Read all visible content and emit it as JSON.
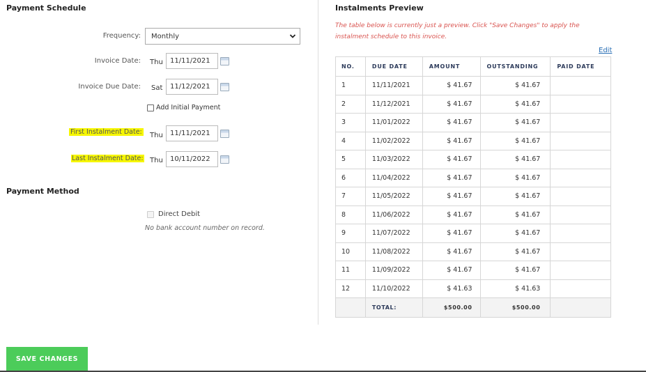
{
  "schedule": {
    "title": "Payment Schedule",
    "frequency_label": "Frequency:",
    "frequency_value": "Monthly",
    "invoice_date_label": "Invoice Date:",
    "invoice_date_day": "Thu",
    "invoice_date_value": "11/11/2021",
    "invoice_due_label": "Invoice Due Date:",
    "invoice_due_day": "Sat",
    "invoice_due_value": "11/12/2021",
    "add_initial_label": "Add Initial Payment",
    "first_inst_label": "First Instalment Date:",
    "first_inst_day": "Thu",
    "first_inst_value": "11/11/2021",
    "last_inst_label": "Last Instalment Date:",
    "last_inst_day": "Thu",
    "last_inst_value": "10/11/2022"
  },
  "method": {
    "title": "Payment Method",
    "direct_debit_label": "Direct Debit",
    "no_bank_text": "No bank account number on record."
  },
  "preview": {
    "title": "Instalments Preview",
    "note_line1": "The table below is currently just a preview. Click \"Save Changes\" to apply the",
    "note_line2": "instalment schedule to this invoice.",
    "edit_label": "Edit",
    "headers": {
      "no": "NO.",
      "due_date": "DUE DATE",
      "amount": "AMOUNT",
      "outstanding": "OUTSTANDING",
      "paid_date": "PAID DATE"
    },
    "rows": [
      {
        "no": "1",
        "due": "11/11/2021",
        "amount": "$ 41.67",
        "outstanding": "$ 41.67",
        "paid": ""
      },
      {
        "no": "2",
        "due": "11/12/2021",
        "amount": "$ 41.67",
        "outstanding": "$ 41.67",
        "paid": ""
      },
      {
        "no": "3",
        "due": "11/01/2022",
        "amount": "$ 41.67",
        "outstanding": "$ 41.67",
        "paid": ""
      },
      {
        "no": "4",
        "due": "11/02/2022",
        "amount": "$ 41.67",
        "outstanding": "$ 41.67",
        "paid": ""
      },
      {
        "no": "5",
        "due": "11/03/2022",
        "amount": "$ 41.67",
        "outstanding": "$ 41.67",
        "paid": ""
      },
      {
        "no": "6",
        "due": "11/04/2022",
        "amount": "$ 41.67",
        "outstanding": "$ 41.67",
        "paid": ""
      },
      {
        "no": "7",
        "due": "11/05/2022",
        "amount": "$ 41.67",
        "outstanding": "$ 41.67",
        "paid": ""
      },
      {
        "no": "8",
        "due": "11/06/2022",
        "amount": "$ 41.67",
        "outstanding": "$ 41.67",
        "paid": ""
      },
      {
        "no": "9",
        "due": "11/07/2022",
        "amount": "$ 41.67",
        "outstanding": "$ 41.67",
        "paid": ""
      },
      {
        "no": "10",
        "due": "11/08/2022",
        "amount": "$ 41.67",
        "outstanding": "$ 41.67",
        "paid": ""
      },
      {
        "no": "11",
        "due": "11/09/2022",
        "amount": "$ 41.67",
        "outstanding": "$ 41.67",
        "paid": ""
      },
      {
        "no": "12",
        "due": "11/10/2022",
        "amount": "$ 41.63",
        "outstanding": "$ 41.63",
        "paid": ""
      }
    ],
    "total_label": "TOTAL:",
    "total_amount": "$500.00",
    "total_outstanding": "$500.00"
  },
  "actions": {
    "save_label": "SAVE CHANGES"
  },
  "icons": {
    "calendar": "calendar-icon",
    "dropdown": "chevron-down-icon"
  },
  "colors": {
    "highlight": "#f6f600",
    "save_button": "#4ccc5a",
    "note_red": "#d9534f",
    "link": "#2a6fb5"
  }
}
